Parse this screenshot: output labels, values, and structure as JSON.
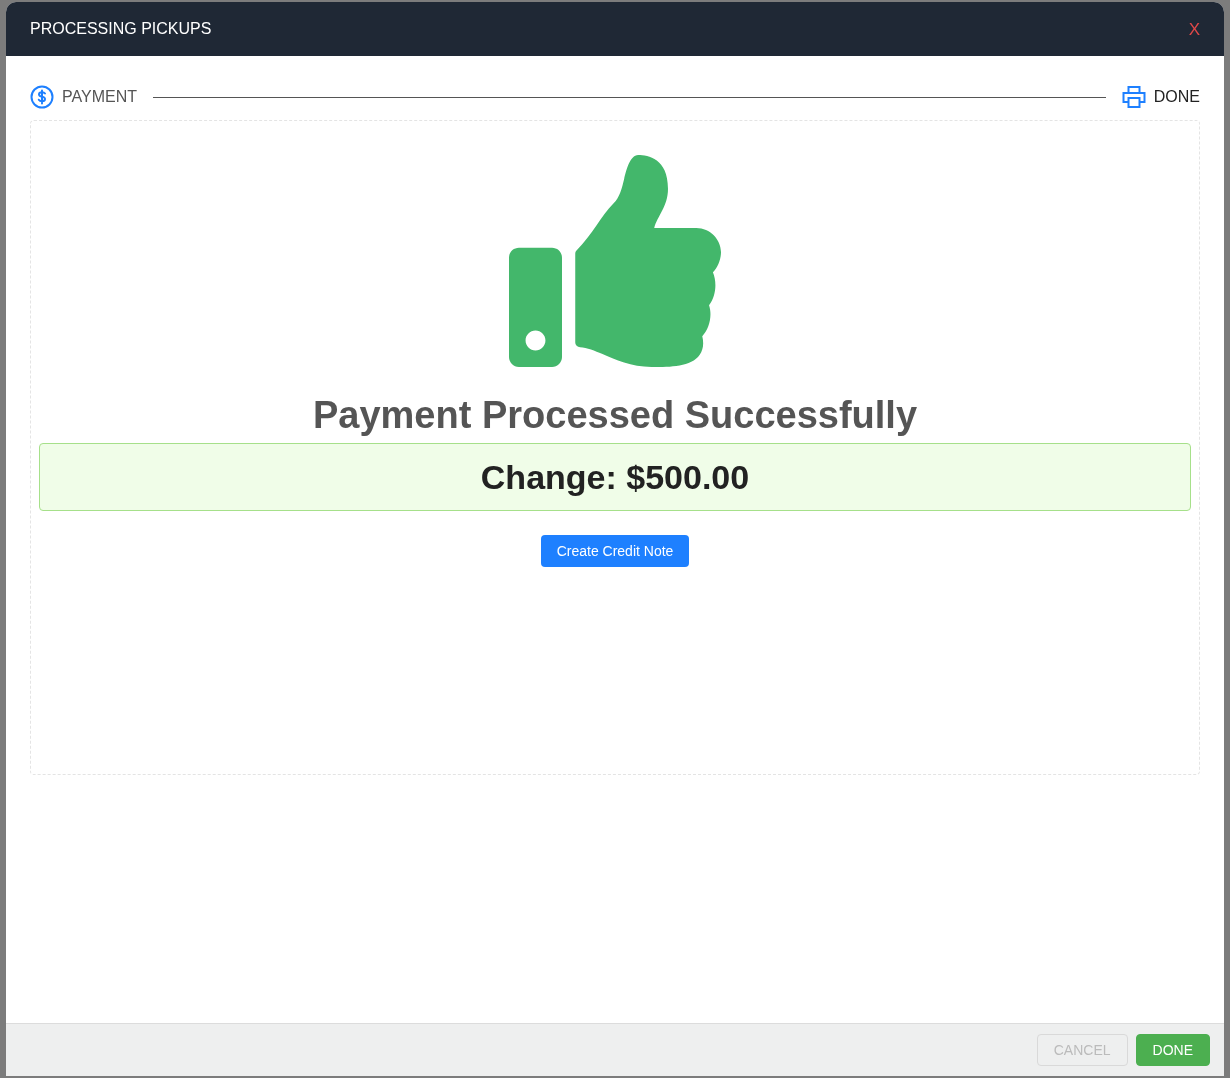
{
  "dialog": {
    "title": "PROCESSING PICKUPS",
    "close": "X"
  },
  "steps": [
    {
      "label": "PAYMENT",
      "kind": "payment",
      "selected": false
    },
    {
      "label": "DONE",
      "kind": "print",
      "selected": true
    }
  ],
  "result": {
    "heading": "Payment Processed Successfully",
    "change": "Change: $500.00",
    "action": "Create Credit Note"
  },
  "footer": {
    "buttons": [
      {
        "label": "CANCEL",
        "kind": "secondary",
        "disabled": true
      },
      {
        "label": "DONE",
        "kind": "primary",
        "disabled": false
      }
    ]
  }
}
